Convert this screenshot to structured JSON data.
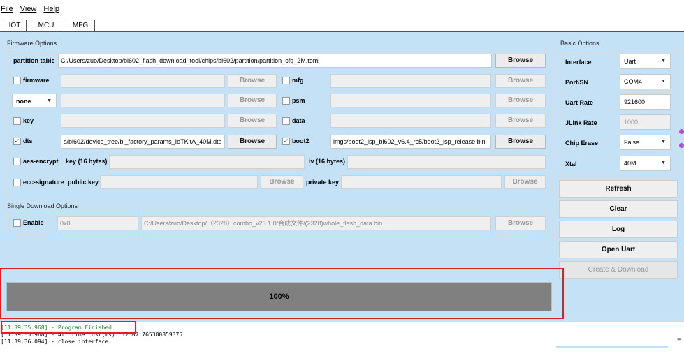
{
  "window": {
    "title": ""
  },
  "menu": {
    "file": "File",
    "view": "View",
    "help": "Help"
  },
  "tabs": [
    {
      "label": "IOT"
    },
    {
      "label": "MCU"
    },
    {
      "label": "MFG"
    }
  ],
  "firmware_options": {
    "title": "Firmware Options",
    "partition_table": {
      "label": "partition table",
      "value": "C:/Users/zuo/Desktop/bl602_flash_download_tool/chips/bl602/partition/partition_cfg_2M.toml",
      "browse": "Browse"
    },
    "firmware": {
      "label": "firmware",
      "checked": false,
      "value": "",
      "browse": "Browse"
    },
    "mfg": {
      "label": "mfg",
      "checked": false,
      "value": "",
      "browse": "Browse"
    },
    "none_select": {
      "value": "none"
    },
    "none_browse": "Browse",
    "psm": {
      "label": "psm",
      "checked": false,
      "value": "",
      "browse": "Browse"
    },
    "key": {
      "label": "key",
      "checked": false,
      "value": "",
      "browse": "Browse"
    },
    "data": {
      "label": "data",
      "checked": false,
      "value": "",
      "browse": "Browse"
    },
    "dts": {
      "label": "dts",
      "checked": true,
      "check_mark": "✓",
      "value": "s/bl602/device_tree/bl_factory_params_IoTKitA_40M.dts",
      "browse": "Browse"
    },
    "boot2": {
      "label": "boot2",
      "checked": true,
      "check_mark": "✓",
      "value": "imgs/boot2_isp_bl602_v6.4_rc5/boot2_isp_release.bin",
      "browse": "Browse"
    },
    "aes_encrypt": {
      "label": "aes-encrypt",
      "key_label": "key (16 bytes)",
      "iv_label": "iv (16 bytes)"
    },
    "ecc_signature": {
      "label": "ecc-signature",
      "public_key_label": "public key",
      "browse": "Browse",
      "private_key_label": "private key",
      "browse2": "Browse"
    }
  },
  "single_download": {
    "title": "Single Download Options",
    "enable_label": "Enable",
    "address": "0x0",
    "file": "C:/Users/zuo/Desktop/（2328）combo_v23.1.0/合成文件/(2328)whole_flash_data.bin",
    "browse": "Browse"
  },
  "basic_options": {
    "title": "Basic Options",
    "interface": {
      "label": "Interface",
      "value": "Uart"
    },
    "port": {
      "label": "Port/SN",
      "value": "COM4"
    },
    "uart_rate": {
      "label": "Uart Rate",
      "value": "921600"
    },
    "jlink_rate": {
      "label": "JLink Rate",
      "value": "1000"
    },
    "chip_erase": {
      "label": "Chip Erase",
      "value": "False"
    },
    "xtal": {
      "label": "Xtal",
      "value": "40M"
    }
  },
  "actions": {
    "refresh": "Refresh",
    "clear": "Clear",
    "log": "Log",
    "open_uart": "Open Uart",
    "create_download": "Create & Download"
  },
  "progress": {
    "percent": 100,
    "label": "100%"
  },
  "console_lines": [
    {
      "time": "[11:39:35.968]",
      "text": " - Program Finished"
    },
    {
      "time": "[11:39:35.968]",
      "text": " - All time cost(ms): 12307.765380859375"
    },
    {
      "time": "[11:39:36.094]",
      "text": " - close interface"
    }
  ],
  "colors": {
    "background": "#c5e1f6",
    "progress": "#808080",
    "highlight": "#e02020",
    "console_ok": "#1a8a1a"
  }
}
